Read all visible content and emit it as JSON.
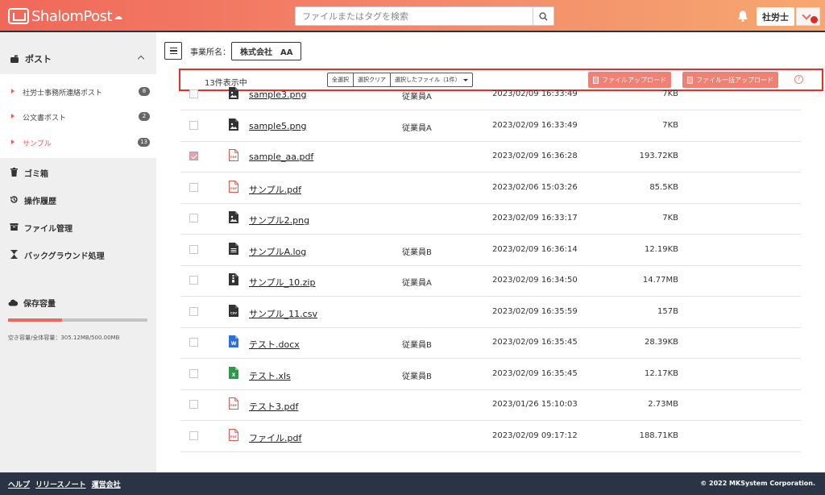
{
  "header": {
    "logo_text": "ShalomPost",
    "search_placeholder": "ファイルまたはタグを検索",
    "user_label": "社労士"
  },
  "sidebar": {
    "post_label": "ポスト",
    "sub_items": [
      {
        "label": "社労士事務所連絡ポスト",
        "badge": "8"
      },
      {
        "label": "公文書ポスト",
        "badge": "2"
      },
      {
        "label": "サンプル",
        "badge": "13"
      }
    ],
    "items": [
      {
        "label": "ゴミ箱",
        "icon": "trash-icon"
      },
      {
        "label": "操作履歴",
        "icon": "history-icon"
      },
      {
        "label": "ファイル管理",
        "icon": "archive-icon"
      },
      {
        "label": "バックグラウンド処理",
        "icon": "hourglass-icon"
      }
    ],
    "storage_label": "保存容量",
    "storage_text": "空き容量/全体容量：305.12MB/500.00MB",
    "storage_used_fraction": 0.39
  },
  "main": {
    "office_label": "事業所名：",
    "office_value": "株式会社　AA",
    "count_text": "13件表示中",
    "select_all": "全選択",
    "clear_selection": "選択クリア",
    "selected_files": "選択したファイル（1件）",
    "upload": "ファイルアップロード",
    "bulk_upload": "ファイル一括アップロード",
    "help": "?"
  },
  "files": [
    {
      "name": "sample3.png",
      "type": "image",
      "owner": "従業員A",
      "date": "2023/02/09 16:33:49",
      "size": "7KB",
      "checked": false
    },
    {
      "name": "sample5.png",
      "type": "image",
      "owner": "従業員A",
      "date": "2023/02/09 16:33:49",
      "size": "7KB",
      "checked": false
    },
    {
      "name": "sample_aa.pdf",
      "type": "pdf",
      "owner": "",
      "date": "2023/02/09 16:36:28",
      "size": "193.72KB",
      "checked": true
    },
    {
      "name": "サンプル.pdf",
      "type": "pdf",
      "owner": "",
      "date": "2023/02/06 15:03:26",
      "size": "85.5KB",
      "checked": false
    },
    {
      "name": "サンプル2.png",
      "type": "image",
      "owner": "",
      "date": "2023/02/09 16:33:17",
      "size": "7KB",
      "checked": false
    },
    {
      "name": "サンプルA.log",
      "type": "text",
      "owner": "従業員B",
      "date": "2023/02/09 16:36:14",
      "size": "12.19KB",
      "checked": false
    },
    {
      "name": "サンプル_10.zip",
      "type": "zip",
      "owner": "従業員A",
      "date": "2023/02/09 16:34:50",
      "size": "14.77MB",
      "checked": false
    },
    {
      "name": "サンプル_11.csv",
      "type": "csv",
      "owner": "",
      "date": "2023/02/09 16:35:59",
      "size": "157B",
      "checked": false
    },
    {
      "name": "テスト.docx",
      "type": "word",
      "owner": "従業員B",
      "date": "2023/02/09 16:35:45",
      "size": "28.39KB",
      "checked": false
    },
    {
      "name": "テスト.xls",
      "type": "excel",
      "owner": "従業員B",
      "date": "2023/02/09 16:35:45",
      "size": "12.17KB",
      "checked": false
    },
    {
      "name": "テスト3.pdf",
      "type": "pdf",
      "owner": "",
      "date": "2023/01/26 15:10:03",
      "size": "2.73MB",
      "checked": false
    },
    {
      "name": "ファイル.pdf",
      "type": "pdf",
      "owner": "",
      "date": "2023/02/09 09:17:12",
      "size": "188.71KB",
      "checked": false
    }
  ],
  "footer": {
    "help": "ヘルプ",
    "release_notes": "リリースノート",
    "company": "運営会社",
    "copyright": "© 2022 MKSystem Corporation."
  },
  "colors": {
    "accent": "#f0685a",
    "header_border": "#2b3340",
    "footer_bg": "#2b3444"
  }
}
